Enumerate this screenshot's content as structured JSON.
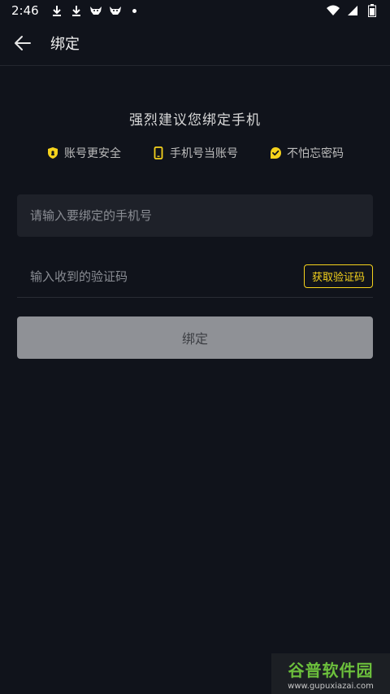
{
  "status_bar": {
    "time": "2:46"
  },
  "app_bar": {
    "title": "绑定"
  },
  "headline": "强烈建议您绑定手机",
  "features": [
    {
      "label": "账号更安全",
      "icon": "shield-icon"
    },
    {
      "label": "手机号当账号",
      "icon": "phone-icon"
    },
    {
      "label": "不怕忘密码",
      "icon": "check-badge-icon"
    }
  ],
  "form": {
    "phone_placeholder": "请输入要绑定的手机号",
    "phone_value": "",
    "code_placeholder": "输入收到的验证码",
    "code_value": "",
    "get_code_label": "获取验证码",
    "submit_label": "绑定"
  },
  "colors": {
    "accent": "#f5d21c",
    "background": "#10131b",
    "input_bg": "#1e2129",
    "disabled_button": "#8f9196"
  },
  "watermark": {
    "title": "谷普软件园",
    "url": "www.gupuxiazai.com"
  }
}
